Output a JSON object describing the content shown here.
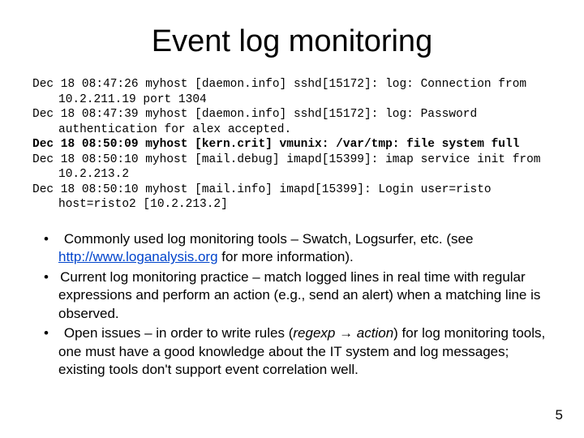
{
  "title": "Event log monitoring",
  "logs": [
    {
      "text": "Dec 18 08:47:26 myhost [daemon.info] sshd[15172]: log: Connection from 10.2.211.19 port 1304",
      "bold": false
    },
    {
      "text": "Dec 18 08:47:39 myhost [daemon.info] sshd[15172]: log: Password authentication for alex accepted.",
      "bold": false
    },
    {
      "text": "Dec 18 08:50:09 myhost [kern.crit] vmunix: /var/tmp: file system full",
      "bold": true
    },
    {
      "text": "Dec 18 08:50:10 myhost [mail.debug] imapd[15399]: imap service init from 10.2.213.2",
      "bold": false
    },
    {
      "text": "Dec 18 08:50:10 myhost [mail.info] imapd[15399]: Login user=risto host=risto2 [10.2.213.2]",
      "bold": false
    }
  ],
  "bullet1_pre": "Commonly used log monitoring tools – Swatch, Logsurfer, etc. (see ",
  "bullet1_link": "http://www.loganalysis.org",
  "bullet1_post": " for more information).",
  "bullet2": "Current log monitoring practice – match logged lines in real time with regular expressions and perform an action (e.g., send an alert) when a matching line is observed.",
  "bullet3_pre": "Open issues – in order to write rules (",
  "bullet3_italic": "regexp → action",
  "bullet3_post": ") for log monitoring tools, one must have a good knowledge about the IT system and log messages; existing tools don't support event correlation well.",
  "page_number": "5"
}
